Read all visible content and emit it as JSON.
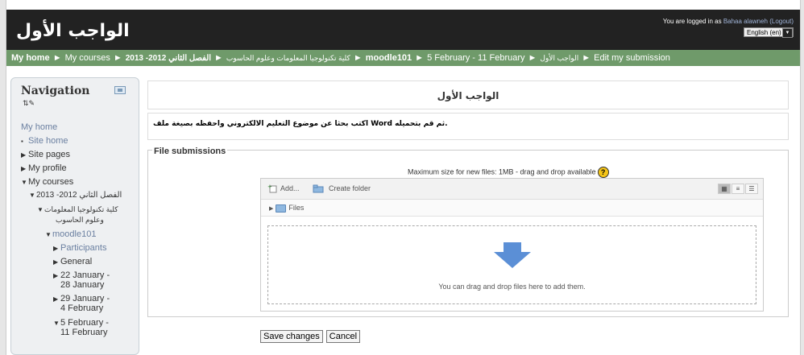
{
  "header": {
    "site_title": "الواجب الأول",
    "login_prefix": "You are logged in as",
    "username": "Bahaa alawneh",
    "logout_label": "(Logout)",
    "language": "English (en)"
  },
  "breadcrumb": [
    {
      "label": "My home",
      "strong": true
    },
    {
      "label": "My courses"
    },
    {
      "label": "كلية تكنولوجيا المعلومات وعلوم الحاسوب"
    },
    {
      "label": "الفصل الثاني 2012- 2013",
      "strong": true
    },
    {
      "label": "moodle101",
      "strong": true
    },
    {
      "label": "5 February - 11 February"
    },
    {
      "label": "الواجب الأول"
    },
    {
      "label": "Edit my submission"
    }
  ],
  "navigation": {
    "title": "Navigation",
    "tools_icon": "move-edit-icons",
    "items": [
      {
        "label": "My home",
        "link": true
      },
      {
        "label": "Site home",
        "bullet": true
      },
      {
        "label": "Site pages",
        "tri": "right"
      },
      {
        "label": "My profile",
        "tri": "right"
      },
      {
        "label": "My courses",
        "tri": "down"
      },
      {
        "label": "الفصل الثاني 2012- 2013",
        "tri": "down"
      },
      {
        "label": "كلية تكنولوجيا المعلومات",
        "tri": "down"
      },
      {
        "label": "وعلوم الحاسوب"
      },
      {
        "label": "moodle101",
        "tri": "down",
        "link": true
      },
      {
        "label": "Participants",
        "tri": "right",
        "link": true
      },
      {
        "label": "General",
        "tri": "right"
      },
      {
        "label": "22 January -",
        "tri": "right"
      },
      {
        "label": "28 January"
      },
      {
        "label": "29 January -",
        "tri": "right"
      },
      {
        "label": "4 February"
      },
      {
        "label": "5 February -",
        "tri": "down"
      },
      {
        "label": "11 February"
      }
    ]
  },
  "assignment": {
    "title": "الواجب الأول",
    "intro": "اكتب بحثا عن موضوع التعليم الالكتروني واحفظه بصيغة ملف Word ثم قم بتحميله."
  },
  "submission": {
    "legend": "File submissions",
    "max_size_text": "Maximum size for new files: 1MB - drag and drop available",
    "help_icon": "help-icon",
    "add_label": "Add...",
    "create_folder_label": "Create folder",
    "path_label": "Files",
    "drop_text": "You can drag and drop files here to add them.",
    "arrow_color": "#5b8fd6"
  },
  "buttons": {
    "save": "Save changes",
    "cancel": "Cancel"
  }
}
